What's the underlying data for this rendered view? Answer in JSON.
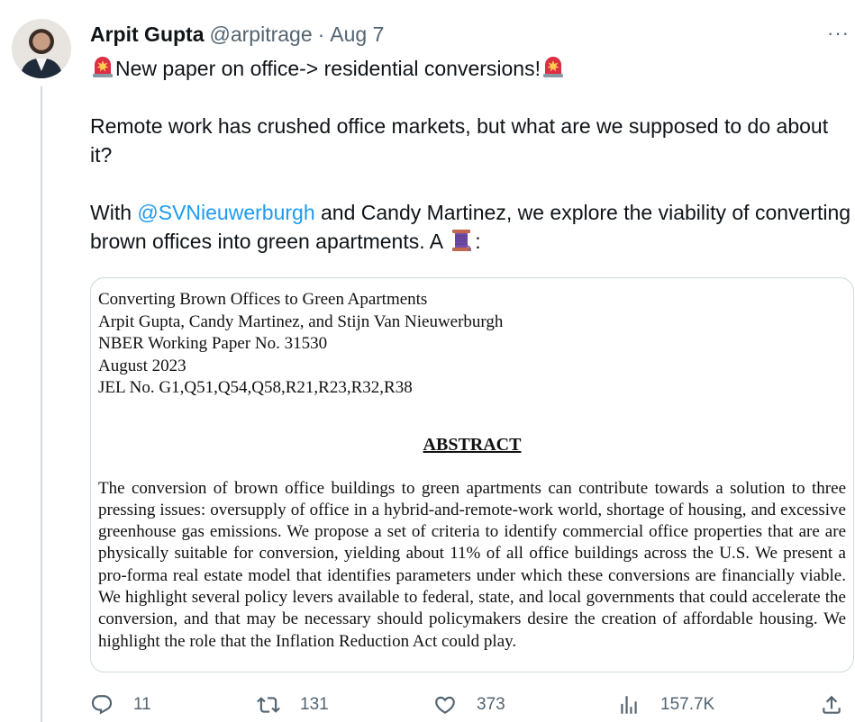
{
  "author": {
    "name": "Arpit Gupta",
    "handle": "@arpitrage",
    "separator": "·",
    "date": "Aug 7"
  },
  "more_label": "···",
  "tweet": {
    "line1_text": "New paper on office-> residential conversions!",
    "line2_text": "Remote work has crushed office markets, but what are we supposed to do about it?",
    "line3_prefix": "With ",
    "line3_mention": "@SVNieuwerburgh",
    "line3_suffix": " and Candy Martinez, we explore the viability of converting brown offices into green apartments. A ",
    "line3_end": ":"
  },
  "paper": {
    "title": "Converting Brown Offices to Green Apartments",
    "authors": "Arpit Gupta, Candy Martinez, and Stijn Van Nieuwerburgh",
    "series": "NBER Working Paper No. 31530",
    "date": "August 2023",
    "jel": "JEL No. G1,Q51,Q54,Q58,R21,R23,R32,R38",
    "abstract_heading": "ABSTRACT",
    "abstract_text": "The conversion of brown office buildings to green apartments can contribute towards a solution to three pressing issues: oversupply of office in a hybrid-and-remote-work world, shortage of housing, and excessive greenhouse gas emissions.  We propose a set of criteria to identify commercial office properties that are are physically suitable for conversion, yielding about 11% of all office buildings across the U.S. We present a pro-forma real estate model that identifies parameters under which these conversions are financially viable. We highlight several policy levers available to federal, state, and local governments that could accelerate the conversion, and that may be necessary should policymakers desire the creation of affordable housing. We highlight the role that the Inflation Reduction Act could play."
  },
  "actions": {
    "replies": "11",
    "retweets": "131",
    "likes": "373",
    "views": "157.7K"
  },
  "icons": [
    "siren-emoji",
    "thread-spool-emoji",
    "reply-icon",
    "retweet-icon",
    "like-icon",
    "views-icon",
    "share-icon"
  ],
  "colors": {
    "link": "#1d9bf0",
    "muted": "#536471",
    "text": "#0f1419",
    "border": "#cfd9de"
  }
}
